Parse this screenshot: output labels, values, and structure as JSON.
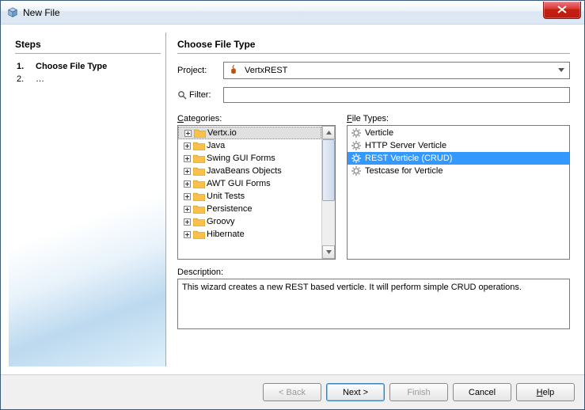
{
  "titlebar": {
    "title": "New File"
  },
  "steps": {
    "heading": "Steps",
    "items": [
      {
        "num": "1.",
        "label": "Choose File Type"
      },
      {
        "num": "2.",
        "label": "…"
      }
    ]
  },
  "main": {
    "heading": "Choose File Type",
    "projectLabel": "Project:",
    "projectValue": "VertxREST",
    "filterLabel": "Filter:",
    "filterValue": "",
    "categoriesLabel": "Categories:",
    "fileTypesLabel": "File Types:",
    "categories": [
      "Vertx.io",
      "Java",
      "Swing GUI Forms",
      "JavaBeans Objects",
      "AWT GUI Forms",
      "Unit Tests",
      "Persistence",
      "Groovy",
      "Hibernate"
    ],
    "fileTypes": [
      "Verticle",
      "HTTP Server Verticle",
      "REST Verticle (CRUD)",
      "Testcase for Verticle"
    ],
    "descriptionLabel": "Description:",
    "description": "This wizard creates a new REST based verticle. It will perform simple CRUD operations."
  },
  "footer": {
    "back": "< Back",
    "next": "Next >",
    "finish": "Finish",
    "cancel": "Cancel",
    "help": "Help"
  }
}
